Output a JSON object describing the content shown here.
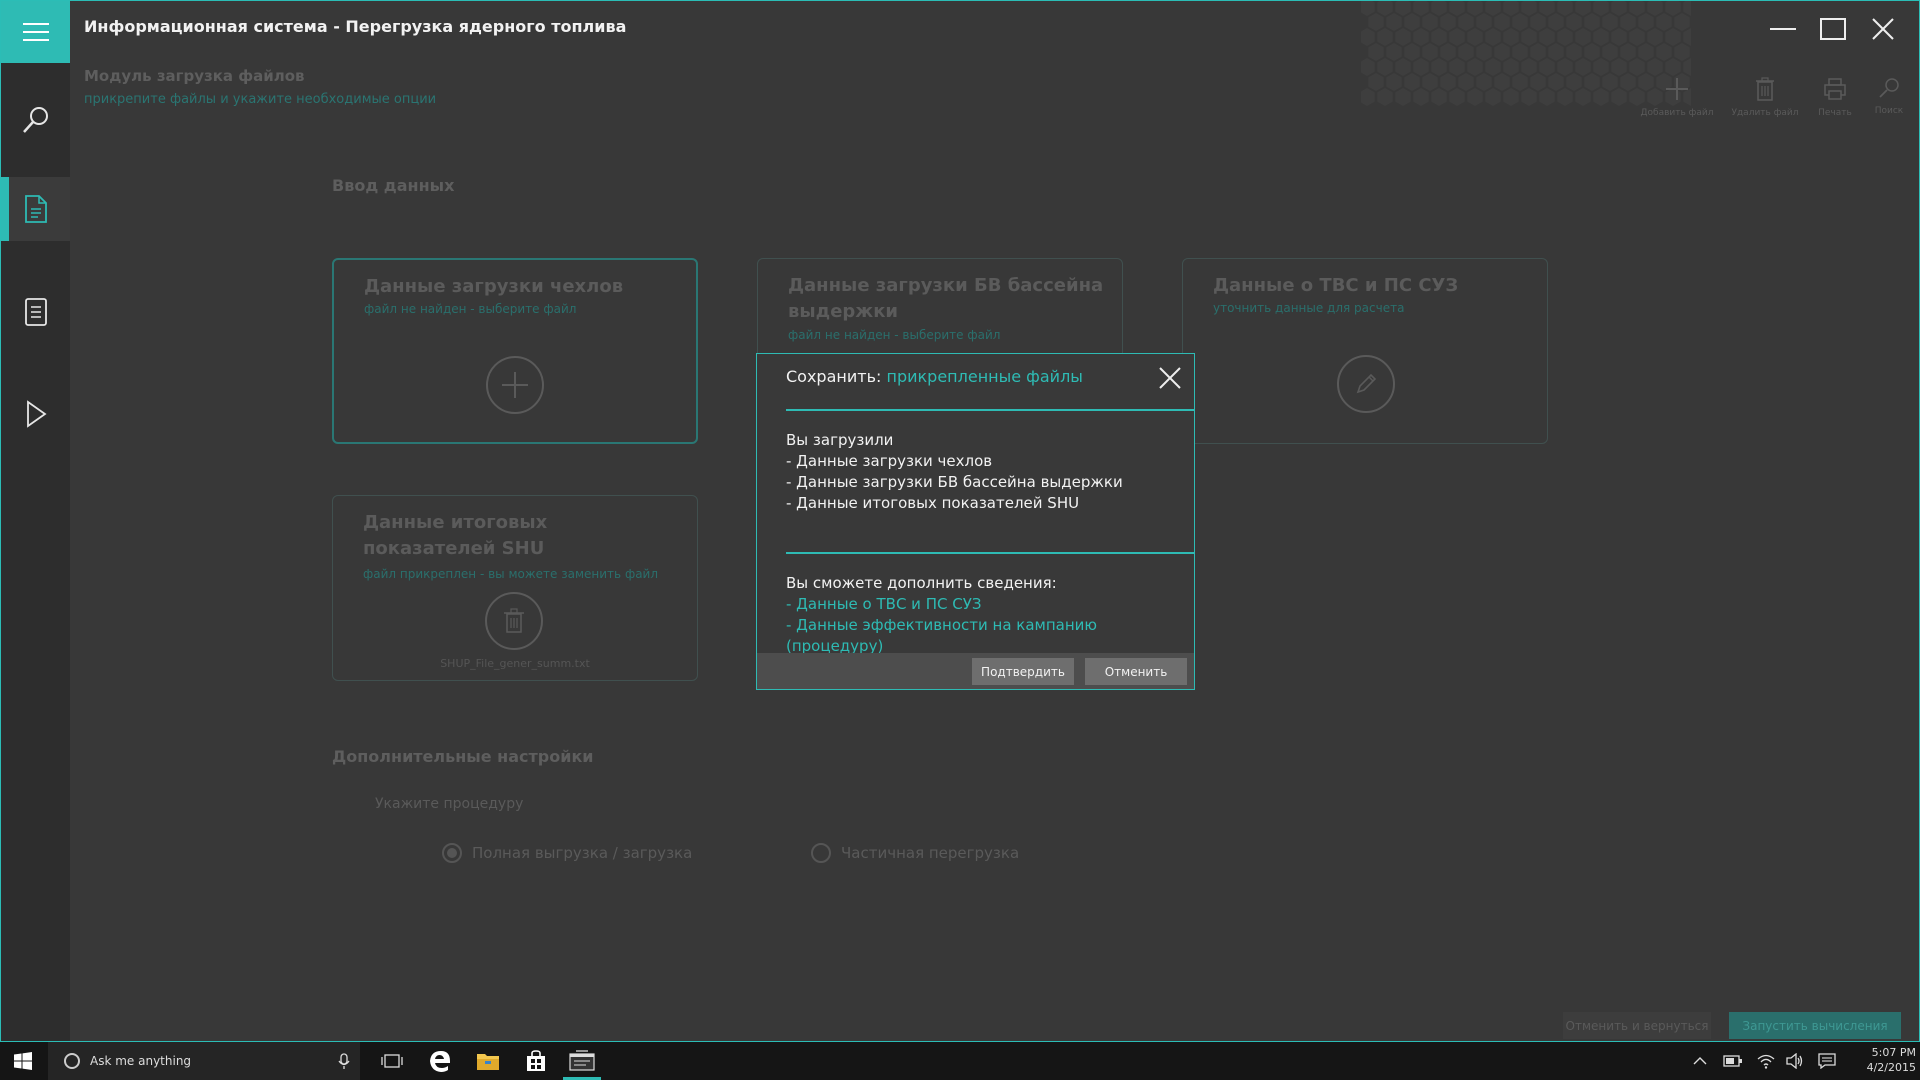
{
  "app": {
    "title": "Информационная система - Перегрузка ядерного топлива"
  },
  "module": {
    "title": "Модуль загрузка файлов",
    "subtitle": "прикрепите файлы и укажите необходимые опции"
  },
  "toolbar": {
    "add_file": "Добавить файл",
    "delete_file": "Удалить файл",
    "print": "Печать",
    "search": "Поиск"
  },
  "input_section": {
    "title": "Ввод данных",
    "cards": [
      {
        "title": "Данные загрузки чехлов",
        "subtitle": "файл не найден - выберите файл",
        "icon": "plus-icon"
      },
      {
        "title": "Данные загрузки БВ бассейна выдержки",
        "subtitle": "файл не найден - выберите файл",
        "icon": "plus-icon"
      },
      {
        "title": "Данные о ТВС и ПС СУЗ",
        "subtitle": "уточнить данные для расчета",
        "icon": "pencil-icon"
      },
      {
        "title": "Данные итоговых показателей SHU",
        "subtitle": "файл прикреплен - вы можете заменить файл",
        "icon": "trash-icon",
        "file": "SHUP_File_gener_summ.txt"
      }
    ]
  },
  "extra_settings": {
    "title": "Дополнительные настройки",
    "procedure_label": "Укажите процедуру",
    "options": [
      {
        "label": "Полная выгрузка / загрузка",
        "selected": true
      },
      {
        "label": "Частичная  перегрузка",
        "selected": false
      }
    ]
  },
  "bottom_actions": {
    "cancel_return": "Отменить и вернуться",
    "run": "Запустить вычисления"
  },
  "modal": {
    "title_prefix": "Сохранить:",
    "title_accent": "прикрепленные файлы",
    "uploaded_heading": "Вы загрузили",
    "uploaded_items": [
      "- Данные загрузки чехлов",
      "- Данные загрузки БВ бассейна выдержки",
      "- Данные итоговых показателей SHU"
    ],
    "extra_heading": "Вы сможете дополнить сведения:",
    "extra_links": [
      "- Данные о ТВС и ПС СУЗ",
      "- Данные эффективности на кампанию (процедуру)"
    ],
    "confirm": "Подтвердить",
    "cancel": "Отменить"
  },
  "taskbar": {
    "search_placeholder": "Ask me anything",
    "time": "5:07 PM",
    "date": "4/2/2015"
  },
  "colors": {
    "accent": "#2ebbb4",
    "background": "#383838",
    "sidebar": "#2d2d2d",
    "taskbar": "#151515"
  }
}
